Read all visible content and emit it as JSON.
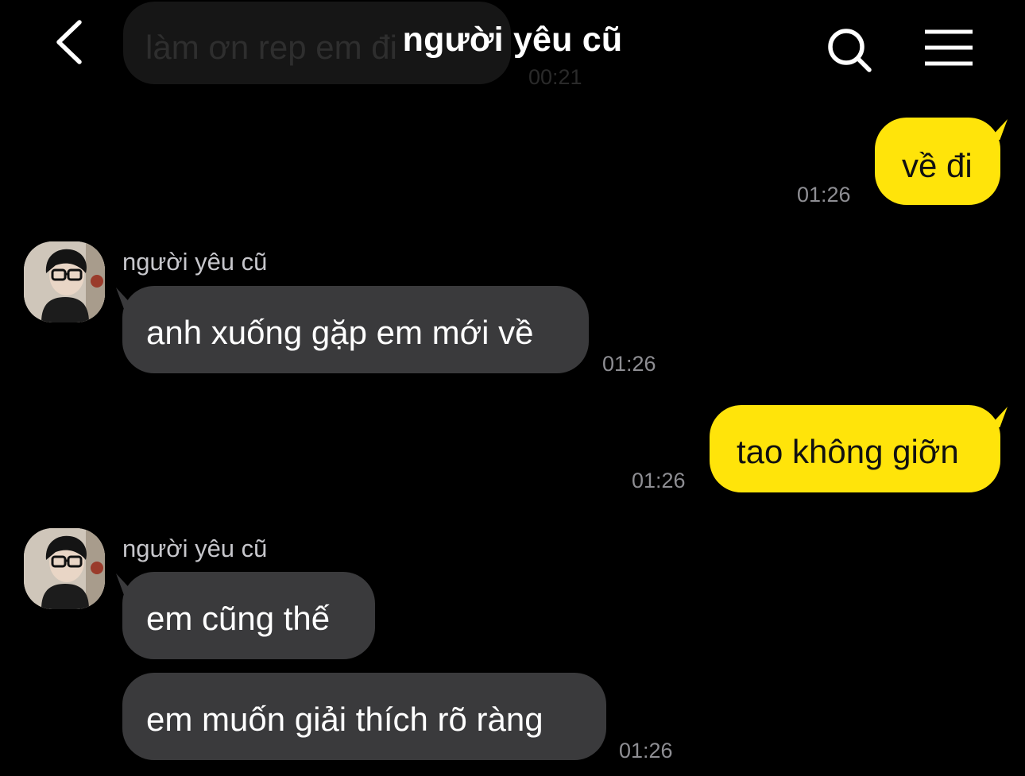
{
  "header": {
    "title": "người yêu cũ"
  },
  "ghost_message": {
    "text": "làm ơn rep em đi",
    "time": "00:21"
  },
  "messages": [
    {
      "direction": "outgoing",
      "text": "về đi",
      "time": "01:26"
    },
    {
      "direction": "incoming",
      "sender": "người yêu cũ",
      "text": "anh xuống gặp em mới về",
      "time": "01:26"
    },
    {
      "direction": "outgoing",
      "text": "tao không giỡn",
      "time": "01:26"
    },
    {
      "direction": "incoming",
      "sender": "người yêu cũ",
      "text": "em cũng thế"
    },
    {
      "direction": "incoming",
      "text": "em muốn giải thích rõ ràng",
      "time": "01:26"
    }
  ],
  "colors": {
    "outgoing_bubble": "#ffe40a",
    "incoming_bubble": "#3a3a3c",
    "background": "#000000",
    "timestamp": "#8e8e93"
  },
  "icons": [
    "back-chevron-icon",
    "search-icon",
    "menu-icon"
  ]
}
